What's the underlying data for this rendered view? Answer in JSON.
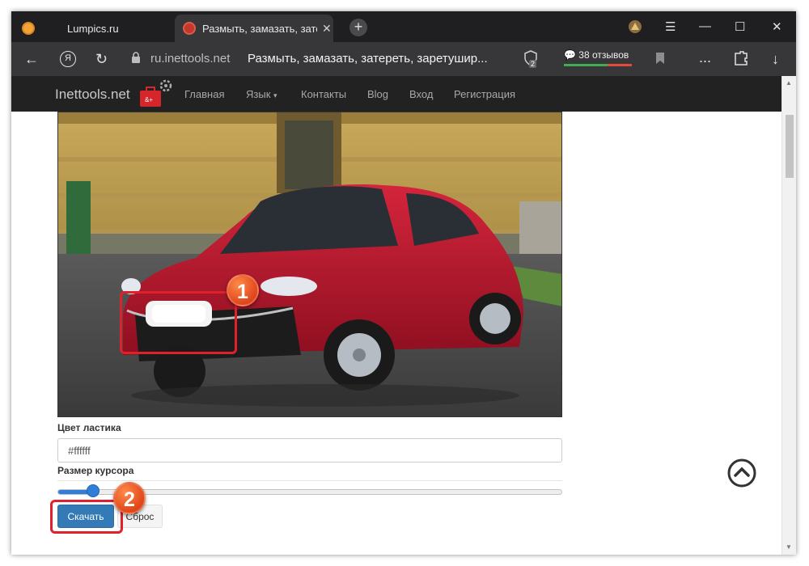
{
  "browser": {
    "tabs": [
      {
        "title": "Lumpics.ru"
      },
      {
        "title": "Размыть, замазать, зате",
        "close_glyph": "✕"
      }
    ],
    "new_tab_glyph": "+",
    "window_controls": {
      "menu": "☰",
      "minimize": "—",
      "maximize": "☐",
      "close": "✕"
    },
    "address": {
      "host": "ru.inettools.net",
      "page_title": "Размыть, замазать, затереть, заретушир..."
    },
    "extensions_badge": "2",
    "reviews": "38 отзывов",
    "nav_glyphs": {
      "back": "←",
      "yandex": "Я",
      "reload": "↻",
      "more": "...",
      "download": "↓"
    }
  },
  "site": {
    "brand": "Inettools.net",
    "nav": [
      {
        "label": "Главная"
      },
      {
        "label": "Язык"
      },
      {
        "label": "Контакты"
      },
      {
        "label": "Blog"
      },
      {
        "label": "Вход"
      },
      {
        "label": "Регистрация"
      }
    ],
    "nav_caret": "▾",
    "editor": {
      "eraser_color_label": "Цвет ластика",
      "eraser_color_value": "#ffffff",
      "cursor_size_label": "Размер курсора",
      "cursor_size_fraction": 0.07,
      "download_button": "Скачать",
      "reset_button": "Сброс"
    }
  },
  "annotations": {
    "step1": "1",
    "step2": "2",
    "highlight_color": "#e0202a"
  },
  "colors": {
    "navbar_bg": "#222222",
    "primary_button": "#337ab7",
    "slider": "#2f7ed8",
    "car_red": "#c0182c"
  }
}
